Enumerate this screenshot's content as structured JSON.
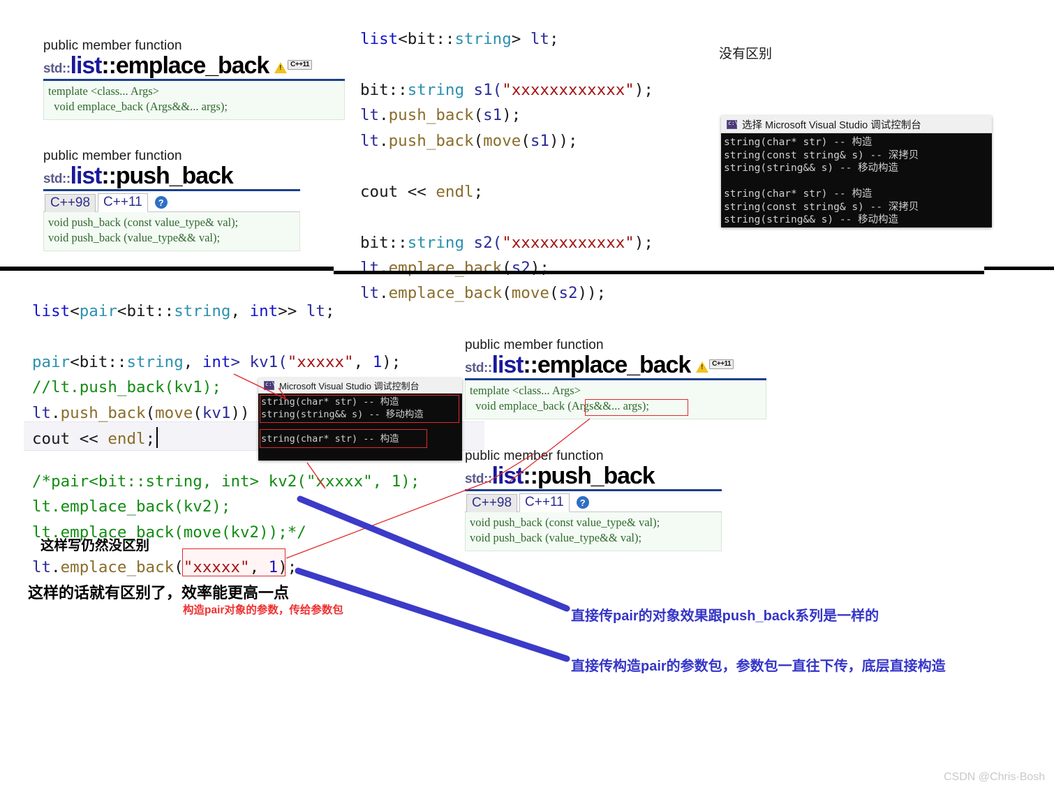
{
  "top": {
    "emplace_card": {
      "kind": "public member function",
      "std_prefix": "std::",
      "name_a": "list",
      "name_sep": "::",
      "name_b": "emplace_back",
      "badge": "C++11",
      "code_line1": "template <class... Args>",
      "code_line2": "  void emplace_back (Args&&... args);"
    },
    "push_card": {
      "kind": "public member function",
      "std_prefix": "std::",
      "name_a": "list",
      "name_sep": "::",
      "name_b": "push_back",
      "tab1": "C++98",
      "tab2": "C++11",
      "help": "?",
      "code_line1": "void push_back (const value_type& val);",
      "code_line2": "void push_back (value_type&& val);"
    },
    "code": {
      "l1_a": "list",
      "l1_b": "<",
      "l1_c": "bit::",
      "l1_d": "string",
      "l1_e": "> ",
      "l1_f": "lt",
      "l1_g": ";",
      "l2_a": "bit::",
      "l2_b": "string",
      "l2_c": " s1(",
      "l2_d": "\"xxxxxxxxxxxx\"",
      "l2_e": ");",
      "l3_a": "lt",
      "l3_b": ".",
      "l3_c": "push_back",
      "l3_d": "(",
      "l3_e": "s1",
      "l3_f": ");",
      "l4_a": "lt",
      "l4_b": ".",
      "l4_c": "push_back",
      "l4_d": "(",
      "l4_e": "move",
      "l4_f": "(",
      "l4_g": "s1",
      "l4_h": "));",
      "l5_a": "cout",
      "l5_b": " << ",
      "l5_c": "endl",
      "l5_d": ";",
      "l6_a": "bit::",
      "l6_b": "string",
      "l6_c": " s2(",
      "l6_d": "\"xxxxxxxxxxxx\"",
      "l6_e": ");",
      "l7_a": "lt",
      "l7_b": ".",
      "l7_c": "emplace_back",
      "l7_d": "(",
      "l7_e": "s2",
      "l7_f": ");",
      "l8_a": "lt",
      "l8_b": ".",
      "l8_c": "emplace_back",
      "l8_d": "(",
      "l8_e": "move",
      "l8_f": "(",
      "l8_g": "s2",
      "l8_h": "));"
    },
    "note_no_diff": "没有区别",
    "console": {
      "title": "选择 Microsoft Visual Studio 调试控制台",
      "lines": [
        "string(char* str) -- 构造",
        "string(const string& s) -- 深拷贝",
        "string(string&& s) -- 移动构造",
        "",
        "string(char* str) -- 构造",
        "string(const string& s) -- 深拷贝",
        "string(string&& s) -- 移动构造"
      ]
    }
  },
  "bottom": {
    "code": {
      "l1_a": "list",
      "l1_b": "<",
      "l1_c": "pair",
      "l1_d": "<",
      "l1_e": "bit::",
      "l1_f": "string",
      "l1_g": ", ",
      "l1_h": "int",
      "l1_i": ">> ",
      "l1_j": "lt",
      "l1_k": ";",
      "l2_a": "pair",
      "l2_b": "<",
      "l2_c": "bit::",
      "l2_d": "string",
      "l2_e": ", ",
      "l2_f": "int",
      "l2_g": "> kv1(",
      "l2_h": "\"xxxxx\"",
      "l2_i": ", ",
      "l2_j": "1",
      "l2_k": ");",
      "l3": "//lt.push_back(kv1);",
      "l4_a": "lt",
      "l4_b": ".",
      "l4_c": "push_back",
      "l4_d": "(",
      "l4_e": "move",
      "l4_f": "(",
      "l4_g": "kv1",
      "l4_h": "))",
      "l5_a": "cout",
      "l5_b": " << ",
      "l5_c": "endl",
      "l5_d": ";",
      "l6": "/*pair<bit::string, int> kv2(\"xxxxx\", 1);",
      "l7": "lt.emplace_back(kv2);",
      "l8": "lt.emplace_back(move(kv2));*/",
      "l9_a": "lt",
      "l9_b": ".",
      "l9_c": "emplace_back",
      "l9_d": "(",
      "l9_e": "\"xxxxx\"",
      "l9_f": ", ",
      "l9_g": "1",
      "l9_h": ");"
    },
    "note_same": "这样写仍然没区别",
    "note_better": "这样的话就有区别了，效率能更高一点",
    "note_red_params": "构造pair对象的参数，传给参数包",
    "note_blue_1": "直接传pair的对象效果跟push_back系列是一样的",
    "note_blue_2": "直接传构造pair的参数包，参数包一直往下传，底层直接构造",
    "console": {
      "title": "Microsoft Visual Studio 调试控制台",
      "lines": [
        "string(char* str) -- 构造",
        "string(string&& s) -- 移动构造",
        "",
        "string(char* str) -- 构造"
      ]
    },
    "emplace_card": {
      "kind": "public member function",
      "std_prefix": "std::",
      "name_a": "list",
      "name_sep": "::",
      "name_b": "emplace_back",
      "badge": "C++11",
      "code_line1": "template <class... Args>",
      "code_line2": "  void emplace_back (Args&&... args);"
    },
    "push_card": {
      "kind": "public member function",
      "std_prefix": "std::",
      "name_a": "list",
      "name_sep": "::",
      "name_b": "push_back",
      "tab1": "C++98",
      "tab2": "C++11",
      "help": "?",
      "code_line1": "void push_back (const value_type& val);",
      "code_line2": "void push_back (value_type&& val);"
    }
  },
  "watermark": "CSDN @Chris·Bosh",
  "colors": {
    "accent_blue": "#3535c8",
    "annot_red": "#f03030",
    "code_string": "#a31515",
    "code_comment": "#128c12",
    "code_type": "#2b91af",
    "console_bg": "#0c0c0c"
  }
}
